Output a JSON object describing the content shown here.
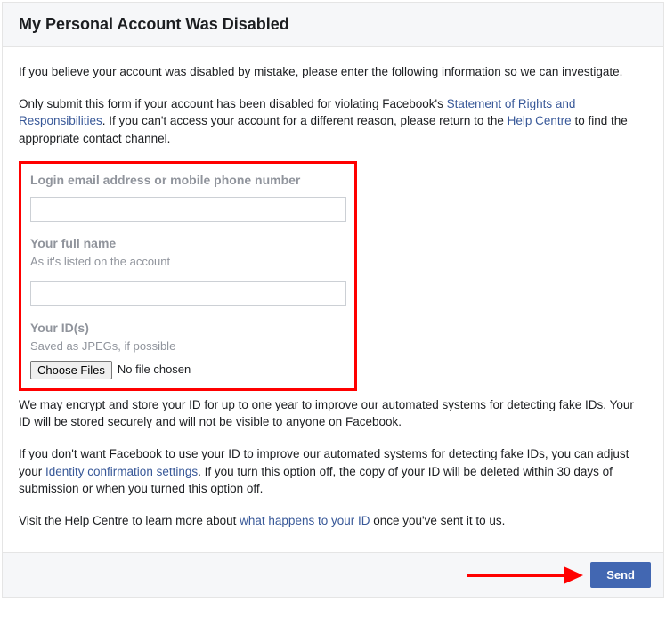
{
  "header": {
    "title": "My Personal Account Was Disabled"
  },
  "intro": "If you believe your account was disabled by mistake, please enter the following information so we can investigate.",
  "disclaimer": {
    "part1": "Only submit this form if your account has been disabled for violating Facebook's ",
    "link1": "Statement of Rights and Responsibilities",
    "part2": ". If you can't access your account for a different reason, please return to the ",
    "link2": "Help Centre",
    "part3": " to find the appropriate contact channel."
  },
  "form": {
    "login": {
      "label": "Login email address or mobile phone number"
    },
    "name": {
      "label": "Your full name",
      "hint": "As it's listed on the account"
    },
    "ids": {
      "label": "Your ID(s)",
      "hint": "Saved as JPEGs, if possible",
      "choose": "Choose Files",
      "nofile": "No file chosen"
    }
  },
  "storage": "We may encrypt and store your ID for up to one year to improve our automated systems for detecting fake IDs. Your ID will be stored securely and will not be visible to anyone on Facebook.",
  "optout": {
    "part1": "If you don't want Facebook to use your ID to improve our automated systems for detecting fake IDs, you can adjust your ",
    "link": "Identity confirmation settings",
    "part2": ". If you turn this option off, the copy of your ID will be deleted within 30 days of submission or when you turned this option off."
  },
  "learn": {
    "part1": "Visit the Help Centre to learn more about ",
    "link": "what happens to your ID",
    "part2": " once you've sent it to us."
  },
  "footer": {
    "send": "Send"
  }
}
